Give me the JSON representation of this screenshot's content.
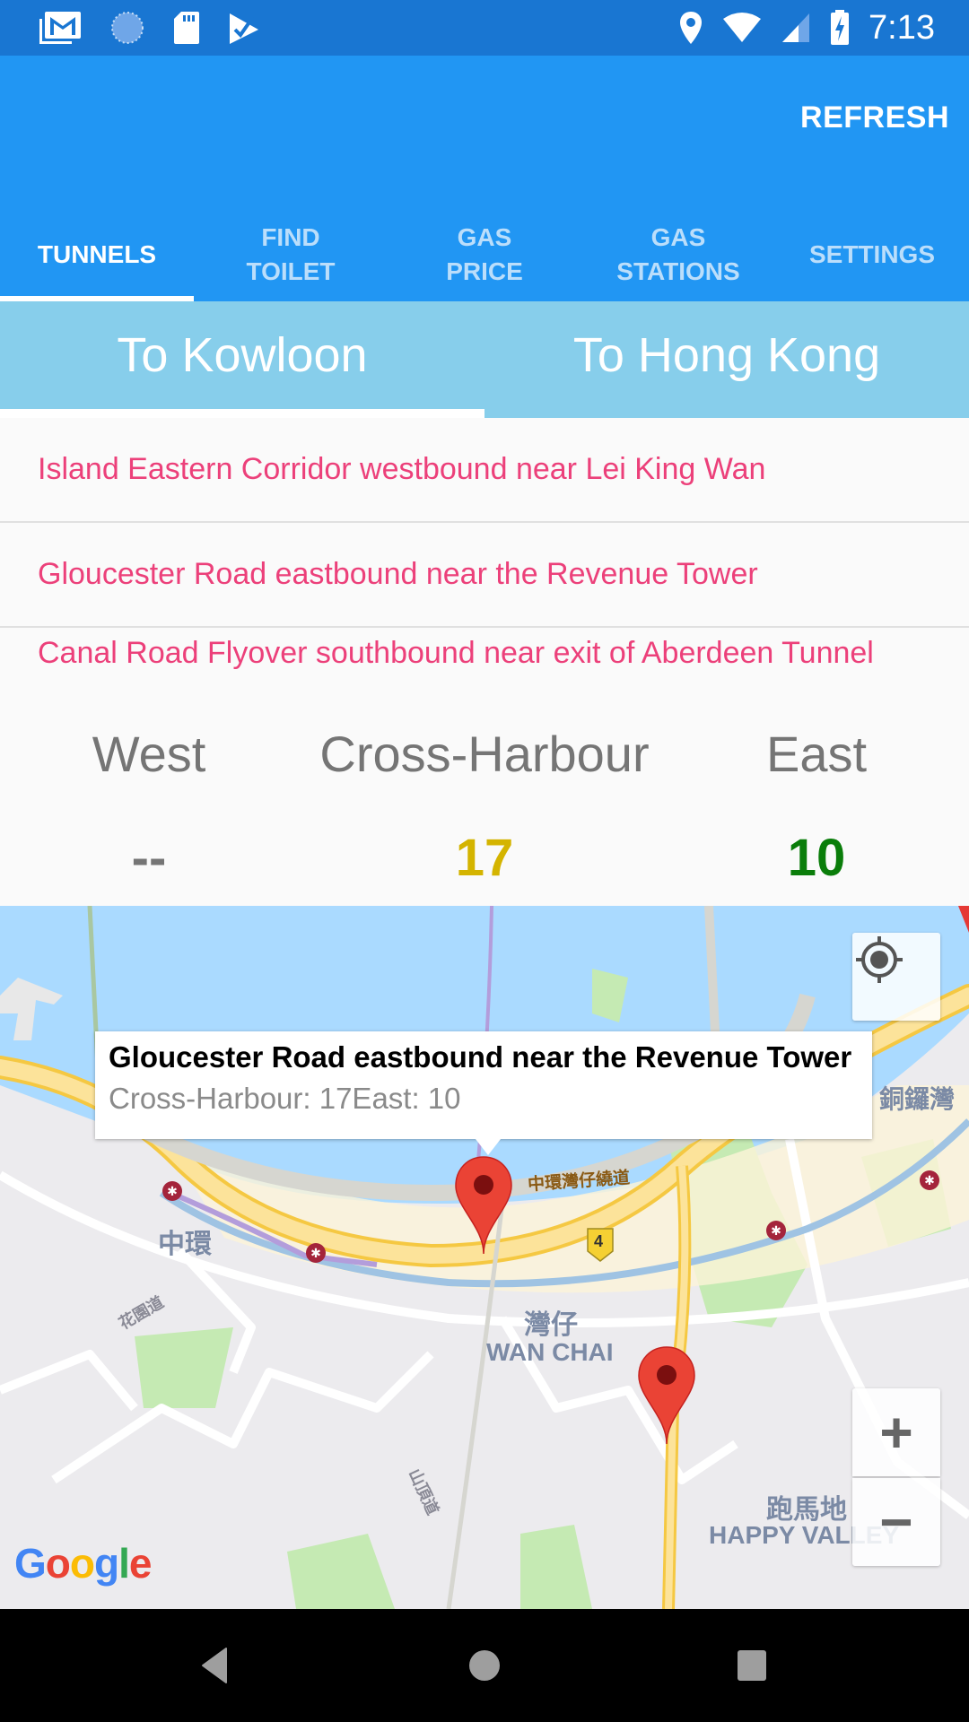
{
  "status_bar": {
    "time": "7:13",
    "left_icons": [
      "gmail-icon",
      "sync-icon",
      "sd-card-icon",
      "play-store-check-icon"
    ],
    "right_icons": [
      "location-icon",
      "wifi-icon",
      "cell-signal-icon",
      "battery-charging-icon"
    ]
  },
  "app_bar": {
    "action_label": "REFRESH",
    "tabs": [
      {
        "label": "TUNNELS",
        "active": true
      },
      {
        "label": "FIND\nTOILET",
        "active": false
      },
      {
        "label": "GAS\nPRICE",
        "active": false
      },
      {
        "label": "GAS\nSTATIONS",
        "active": false
      },
      {
        "label": "SETTINGS",
        "active": false
      }
    ]
  },
  "direction_tabs": [
    {
      "label": "To Kowloon",
      "active": true
    },
    {
      "label": "To Hong Kong",
      "active": false
    }
  ],
  "locations": [
    "Island Eastern Corridor westbound near Lei King Wan",
    "Gloucester Road eastbound near the Revenue Tower",
    "Canal Road Flyover southbound near exit of Aberdeen Tunnel"
  ],
  "tunnel_times": {
    "columns": [
      {
        "label": "West",
        "value": "--",
        "color": "#757575"
      },
      {
        "label": "Cross-Harbour",
        "value": "17",
        "color": "#d4b400"
      },
      {
        "label": "East",
        "value": "10",
        "color": "#0a7d0a"
      }
    ]
  },
  "map": {
    "info_window": {
      "title": "Gloucester Road eastbound near the Revenue Tower",
      "body": "Cross-Harbour: 17East: 10"
    },
    "labels": {
      "central_zh": "中環",
      "wan_chai_zh": "灣仔",
      "wan_chai_en": "WAN CHAI",
      "causeway_bay_zh": "銅鑼灣",
      "happy_valley_zh": "跑馬地",
      "happy_valley_en": "HAPPY VALLEY",
      "bypass_zh": "中環灣仔繞道",
      "garden_road_zh": "花園道",
      "peak_road_zh": "山頂道",
      "road_number": "4"
    },
    "zoom_in_label": "+",
    "zoom_out_label": "−",
    "attribution": "Google"
  },
  "nav_bar": [
    "back-icon",
    "home-icon",
    "recents-icon"
  ]
}
